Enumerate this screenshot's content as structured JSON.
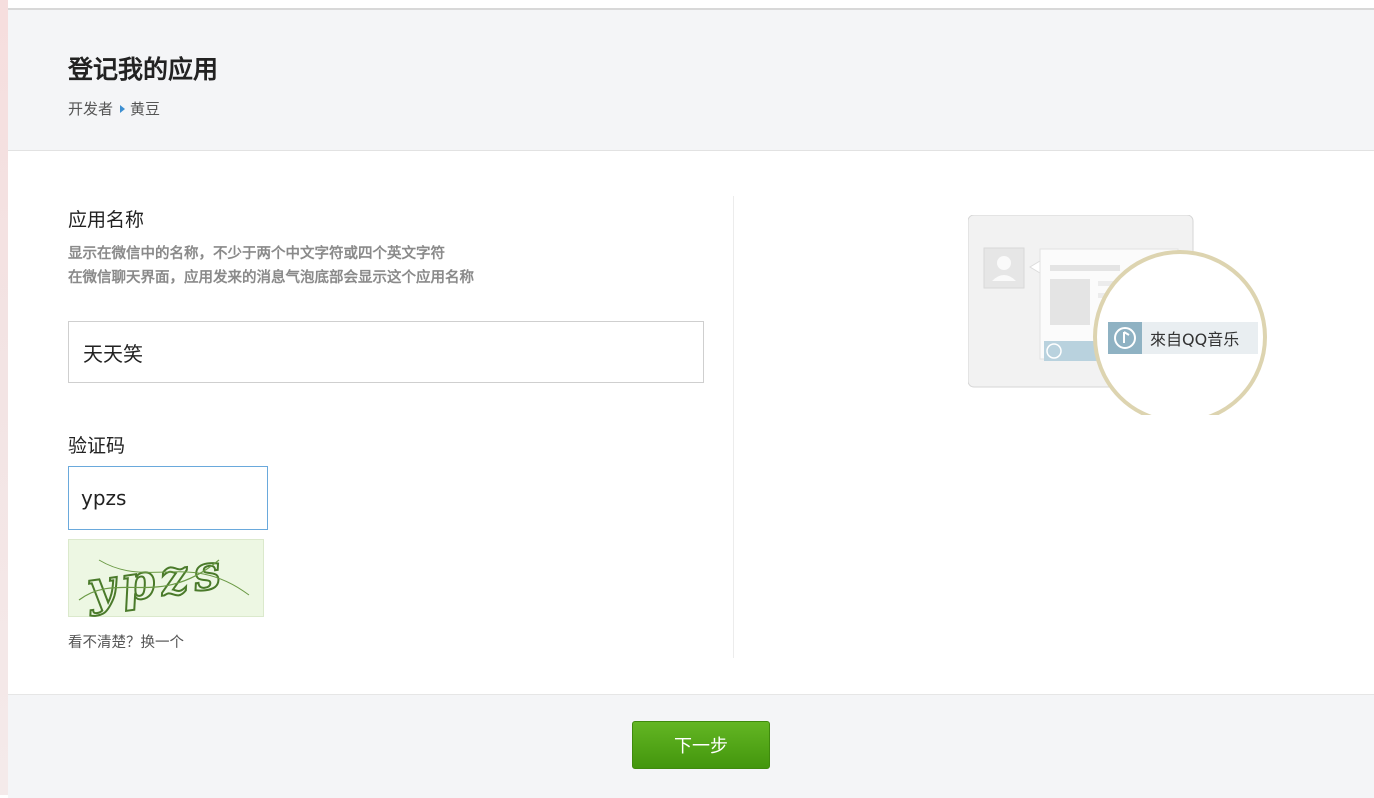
{
  "header": {
    "title": "登记我的应用",
    "breadcrumb": [
      "开发者",
      "黄豆"
    ]
  },
  "form": {
    "app_name": {
      "label": "应用名称",
      "help": [
        "显示在微信中的名称，不少于两个中文字符或四个英文字符",
        "在微信聊天界面，应用发来的消息气泡底部会显示这个应用名称"
      ],
      "value": "天天笑"
    },
    "captcha": {
      "label": "验证码",
      "value": "ypzs",
      "image_text": "ypzs",
      "refresh": "看不清楚？换一个"
    }
  },
  "preview": {
    "source_label": "來自QQ音乐",
    "icon": "music-note-icon"
  },
  "footer": {
    "next_label": "下一步"
  },
  "colors": {
    "accent_green": "#4ea516",
    "focus_blue": "#6aa9dc",
    "header_bg": "#f4f5f7"
  }
}
